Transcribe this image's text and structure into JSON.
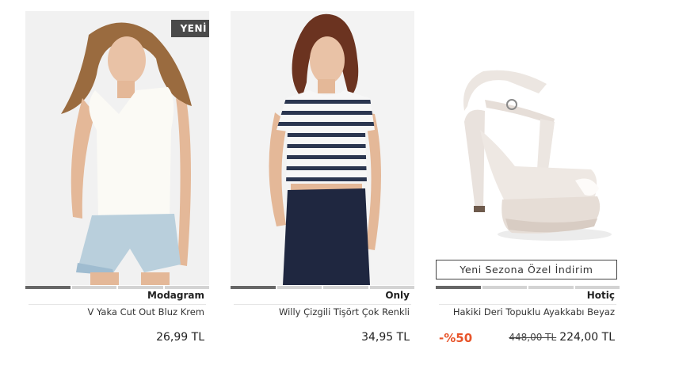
{
  "products": [
    {
      "badge": "YENİ",
      "brand": "Modagram",
      "name": "V Yaka Cut Out Bluz Krem",
      "price": "26,99 TL",
      "slides": 4,
      "active_slide": 0
    },
    {
      "brand": "Only",
      "name": "Willy Çizgili Tişört Çok Renkli",
      "price": "34,95 TL",
      "slides": 4,
      "active_slide": 0
    },
    {
      "promo": "Yeni Sezona Özel İndirim",
      "brand": "Hotiç",
      "name": "Hakiki Deri Topuklu Ayakkabı Beyaz",
      "discount": "-%50",
      "old_price": "448,00 TL",
      "price": "224,00 TL",
      "slides": 4,
      "active_slide": 0
    }
  ],
  "colors": {
    "discount": "#e8542a",
    "badge": "#4a4a4a"
  }
}
